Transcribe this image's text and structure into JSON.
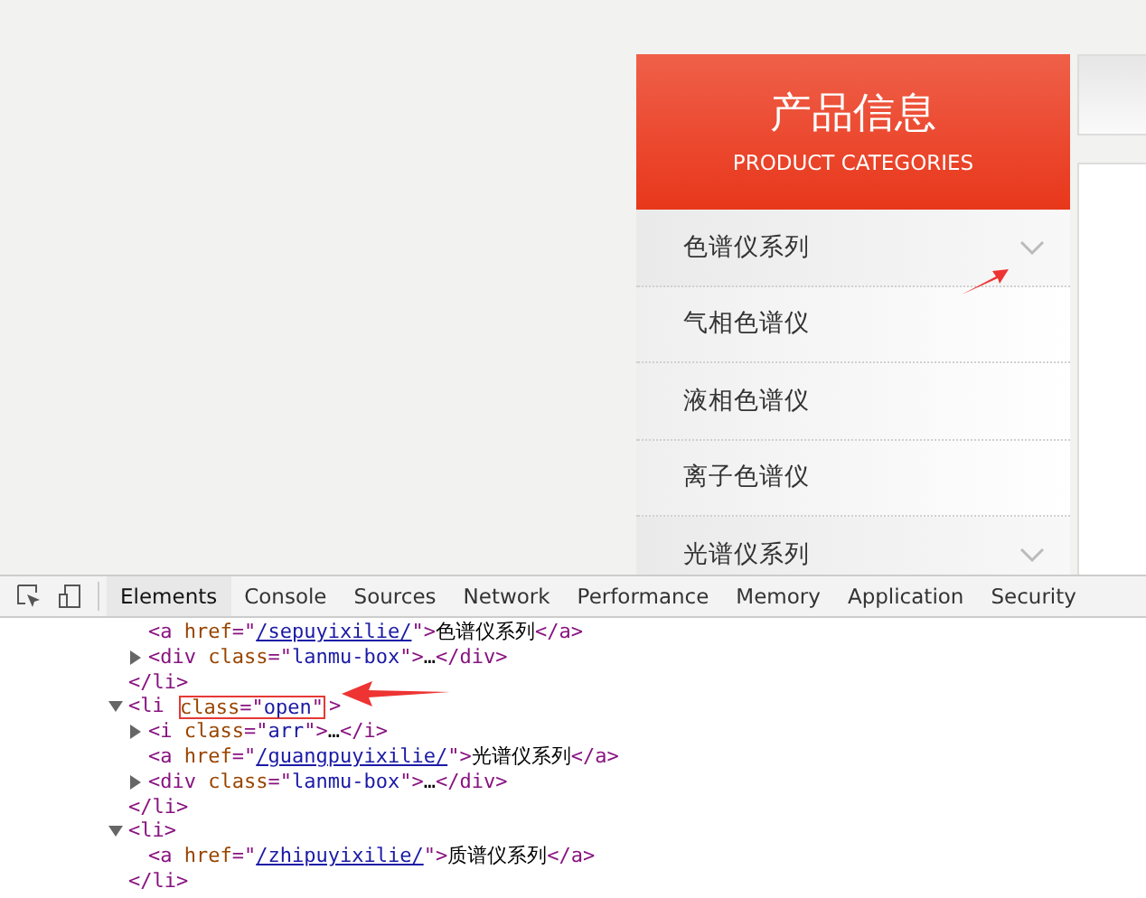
{
  "sidebar": {
    "title": "产品信息",
    "subtitle": "PRODUCT CATEGORIES",
    "items": [
      {
        "label": "色谱仪系列",
        "kind": "category"
      },
      {
        "label": "气相色谱仪",
        "kind": "item"
      },
      {
        "label": "液相色谱仪",
        "kind": "item"
      },
      {
        "label": "离子色谱仪",
        "kind": "item"
      },
      {
        "label": "光谱仪系列",
        "kind": "category"
      }
    ]
  },
  "devtools": {
    "tabs": [
      {
        "label": "Elements",
        "selected": true
      },
      {
        "label": "Console",
        "selected": false
      },
      {
        "label": "Sources",
        "selected": false
      },
      {
        "label": "Network",
        "selected": false
      },
      {
        "label": "Performance",
        "selected": false
      },
      {
        "label": "Memory",
        "selected": false
      },
      {
        "label": "Application",
        "selected": false
      },
      {
        "label": "Security",
        "selected": false
      }
    ],
    "nodes": [
      {
        "children": [
          {
            "tokens": [
              {
                "kind": "tag",
                "text": "<a "
              },
              {
                "kind": "attr",
                "text": "href"
              },
              {
                "kind": "tag",
                "text": "=\""
              },
              {
                "kind": "link",
                "text": "/sepuyixilie/"
              },
              {
                "kind": "tag",
                "text": "\">"
              },
              {
                "kind": "text",
                "text": "色谱仪系列"
              },
              {
                "kind": "tag",
                "text": "</a>"
              }
            ]
          },
          {
            "expanded": false,
            "tokens": [
              {
                "kind": "tag",
                "text": "<div "
              },
              {
                "kind": "attr",
                "text": "class"
              },
              {
                "kind": "tag",
                "text": "=\""
              },
              {
                "kind": "value",
                "text": "lanmu-box"
              },
              {
                "kind": "tag",
                "text": "\">"
              },
              {
                "kind": "text",
                "text": "…"
              },
              {
                "kind": "tag",
                "text": "</div>"
              }
            ]
          }
        ]
      },
      {
        "tokens": [
          {
            "kind": "tag",
            "text": "</li>"
          }
        ]
      },
      {
        "expanded": true,
        "tokens": [
          {
            "kind": "tag",
            "text": "<li "
          },
          {
            "kind": "group",
            "boxed": true,
            "tokens": [
              {
                "kind": "attr",
                "text": "class"
              },
              {
                "kind": "tag",
                "text": "=\""
              },
              {
                "kind": "value",
                "text": "open"
              },
              {
                "kind": "tag",
                "text": "\""
              }
            ]
          },
          {
            "kind": "tag",
            "text": ">"
          }
        ],
        "children": [
          {
            "expanded": false,
            "tokens": [
              {
                "kind": "tag",
                "text": "<i "
              },
              {
                "kind": "attr",
                "text": "class"
              },
              {
                "kind": "tag",
                "text": "=\""
              },
              {
                "kind": "value",
                "text": "arr"
              },
              {
                "kind": "tag",
                "text": "\">"
              },
              {
                "kind": "text",
                "text": "…"
              },
              {
                "kind": "tag",
                "text": "</i>"
              }
            ]
          },
          {
            "tokens": [
              {
                "kind": "tag",
                "text": "<a "
              },
              {
                "kind": "attr",
                "text": "href"
              },
              {
                "kind": "tag",
                "text": "=\""
              },
              {
                "kind": "link",
                "text": "/guangpuyixilie/"
              },
              {
                "kind": "tag",
                "text": "\">"
              },
              {
                "kind": "text",
                "text": "光谱仪系列"
              },
              {
                "kind": "tag",
                "text": "</a>"
              }
            ]
          },
          {
            "expanded": false,
            "tokens": [
              {
                "kind": "tag",
                "text": "<div "
              },
              {
                "kind": "attr",
                "text": "class"
              },
              {
                "kind": "tag",
                "text": "=\""
              },
              {
                "kind": "value",
                "text": "lanmu-box"
              },
              {
                "kind": "tag",
                "text": "\">"
              },
              {
                "kind": "text",
                "text": "…"
              },
              {
                "kind": "tag",
                "text": "</div>"
              }
            ]
          }
        ]
      },
      {
        "tokens": [
          {
            "kind": "tag",
            "text": "</li>"
          }
        ]
      },
      {
        "expanded": true,
        "tokens": [
          {
            "kind": "tag",
            "text": "<li>"
          }
        ],
        "children": [
          {
            "tokens": [
              {
                "kind": "tag",
                "text": "<a "
              },
              {
                "kind": "attr",
                "text": "href"
              },
              {
                "kind": "tag",
                "text": "=\""
              },
              {
                "kind": "link",
                "text": "/zhipuyixilie/"
              },
              {
                "kind": "tag",
                "text": "\">"
              },
              {
                "kind": "text",
                "text": "质谱仪系列"
              },
              {
                "kind": "tag",
                "text": "</a>"
              }
            ]
          }
        ]
      },
      {
        "tokens": [
          {
            "kind": "tag",
            "text": "</li>"
          }
        ]
      }
    ]
  }
}
